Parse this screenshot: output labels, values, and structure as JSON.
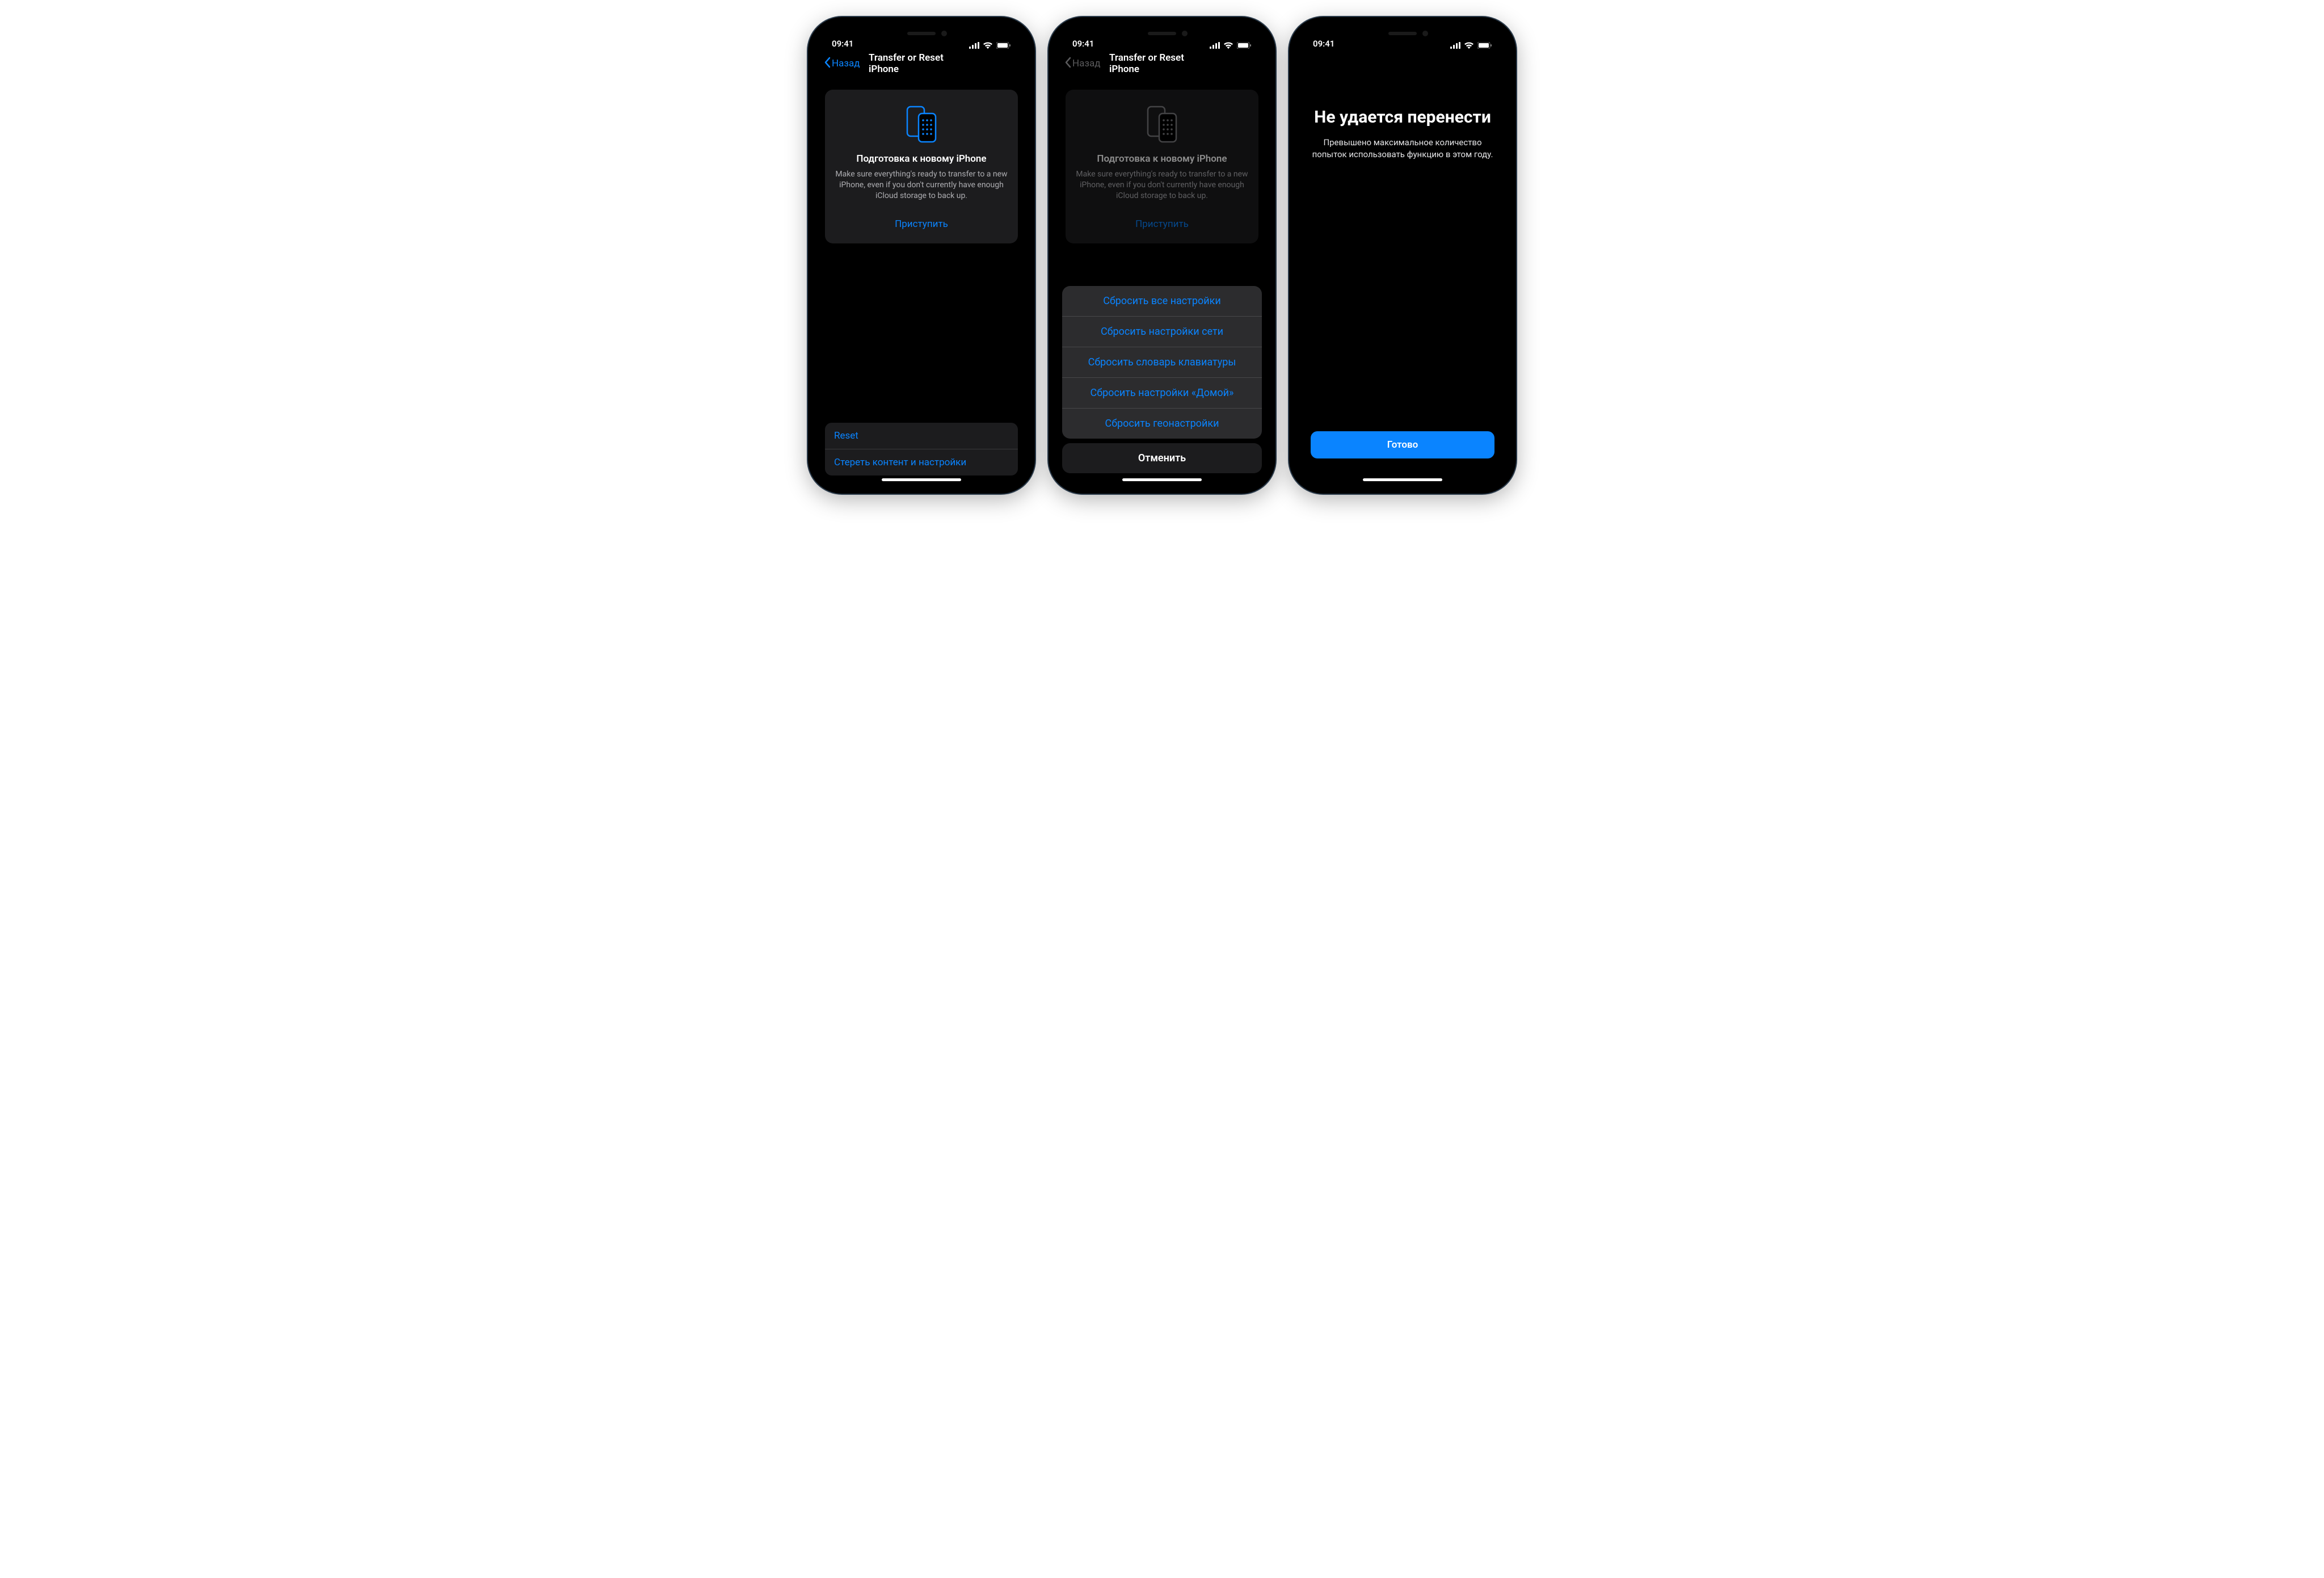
{
  "status": {
    "time": "09:41"
  },
  "nav": {
    "back_label": "Назад",
    "title": "Transfer or Reset iPhone"
  },
  "card": {
    "title": "Подготовка к новому iPhone",
    "desc": "Make sure everything's ready to transfer to a new iPhone, even if you don't currently have enough iCloud storage to back up.",
    "action": "Приступить"
  },
  "list": {
    "reset": "Reset",
    "erase": "Стереть контент и настройки"
  },
  "sheet": {
    "items": [
      "Сбросить все настройки",
      "Сбросить настройки сети",
      "Сбросить словарь клавиатуры",
      "Сбросить настройки «Домой»",
      "Сбросить геонастройки"
    ],
    "cancel": "Отменить"
  },
  "modal": {
    "title": "Не удается перенести",
    "desc": "Превышено максимальное количество попыток использовать функцию в этом году.",
    "done": "Готово"
  }
}
